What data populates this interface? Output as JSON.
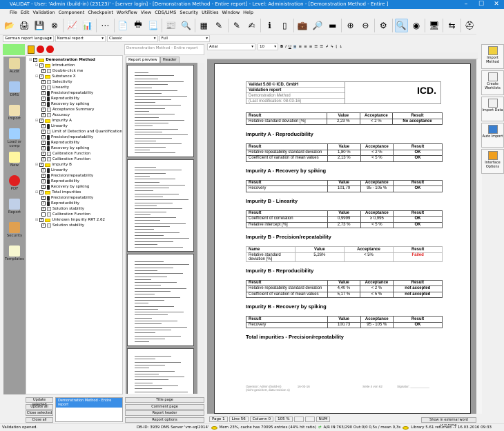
{
  "window": {
    "title": "VALIDAT - User: 'Admin (build-in) (23123)' - [server login] - [Demonstration Method - Entire report] - Level: Administration - [Demonstration Method - Entire ]"
  },
  "menu": [
    "File",
    "Edit",
    "Validation",
    "Component",
    "Checkpoint",
    "Workflow",
    "View",
    "CDS/LIMS",
    "Security",
    "Utilities",
    "Window",
    "Help"
  ],
  "toolbar_icons": [
    "open-icon",
    "print-preview-icon",
    "save-icon",
    "close-icon",
    "chart-icon",
    "bar-chart-icon",
    "network-icon",
    "pdf-icon",
    "print-icon",
    "document-icon",
    "report-icon",
    "search-doc-icon",
    "calculator-icon",
    "edit-icon",
    "edit2-icon",
    "signature-icon",
    "info-doc-icon",
    "page-icon",
    "briefcase-icon",
    "magnify-doc-icon",
    "terminal-icon",
    "zoom-in-icon",
    "zoom-out-icon",
    "refresh-gear-icon",
    "search-icon",
    "auto-import-icon",
    "monitor-icon",
    "exit-icon",
    "help-icon"
  ],
  "options": {
    "language": "German report language",
    "report_type": "Normal report",
    "style": "Classic",
    "scope": "Full"
  },
  "leftnav": [
    "Audit",
    "DMS",
    "Import",
    "Load or comp",
    "New",
    "PDF",
    "Report",
    "Security",
    "Templates"
  ],
  "tree": [
    {
      "d": 0,
      "t": "f",
      "label": "Demonstration Method",
      "bold": true
    },
    {
      "d": 1,
      "t": "f",
      "label": "Introduction"
    },
    {
      "d": 2,
      "t": "d",
      "label": "Double-click me"
    },
    {
      "d": 1,
      "t": "f",
      "label": "Substance X"
    },
    {
      "d": 2,
      "t": "d",
      "label": "Selectivity"
    },
    {
      "d": 2,
      "t": "d",
      "label": "Linearity"
    },
    {
      "d": 2,
      "t": "l",
      "label": "Precision/repeatability"
    },
    {
      "d": 2,
      "t": "l",
      "label": "Reproducibility"
    },
    {
      "d": 2,
      "t": "l",
      "label": "Recovery by spiking"
    },
    {
      "d": 2,
      "t": "d",
      "label": "Acceptance Summary"
    },
    {
      "d": 2,
      "t": "d",
      "label": "Accuracy"
    },
    {
      "d": 1,
      "t": "f",
      "label": "Impurity A"
    },
    {
      "d": 2,
      "t": "l",
      "label": "Linearity"
    },
    {
      "d": 2,
      "t": "d",
      "label": "Limit of Detection and Quantification"
    },
    {
      "d": 2,
      "t": "l",
      "label": "Precision/repeatability"
    },
    {
      "d": 2,
      "t": "l",
      "label": "Reproducibility"
    },
    {
      "d": 2,
      "t": "l",
      "label": "Recovery by spiking"
    },
    {
      "d": 2,
      "t": "d",
      "label": "Calibration Function"
    },
    {
      "d": 2,
      "t": "d",
      "label": "Calibration Function"
    },
    {
      "d": 1,
      "t": "f",
      "label": "Impurity B"
    },
    {
      "d": 2,
      "t": "l",
      "label": "Linearity"
    },
    {
      "d": 2,
      "t": "l",
      "label": "Precision/repeatability"
    },
    {
      "d": 2,
      "t": "l",
      "label": "Reproducibility"
    },
    {
      "d": 2,
      "t": "l",
      "label": "Recovery by spiking"
    },
    {
      "d": 1,
      "t": "f",
      "label": "Total impurities"
    },
    {
      "d": 2,
      "t": "l",
      "label": "Precision/repeatability"
    },
    {
      "d": 2,
      "t": "l",
      "label": "Reproducibility"
    },
    {
      "d": 2,
      "t": "d",
      "label": "Solution stability"
    },
    {
      "d": 2,
      "t": "d",
      "label": "Calibration Function",
      "unchecked": true
    },
    {
      "d": 1,
      "t": "f",
      "label": "Unknown Impurity RRT 2.62"
    },
    {
      "d": 2,
      "t": "d",
      "label": "Solution stability"
    }
  ],
  "middle": {
    "header": "Demonstration Method - Entire report",
    "tabs": [
      "Report preview",
      "Header"
    ]
  },
  "font": {
    "name": "Arial",
    "size": "10",
    "buttons": [
      "B",
      "I",
      "U"
    ]
  },
  "report": {
    "header": [
      "Validat 5.60  © ICD, GmbH",
      "Validation report",
      "Demonstration Method",
      "(Last modification: 08-03-16)"
    ],
    "logo": "ICD.",
    "cols": [
      "Result",
      "Value",
      "Acceptance",
      "Result"
    ],
    "sections": [
      {
        "title": "",
        "rows": [
          [
            "Relative standard deviation [%]",
            "2,23 %",
            "< 2 %",
            "No acceptance"
          ]
        ]
      },
      {
        "title": "Impurity A - Reproducibility",
        "rows": [
          [
            "Relative repeatability standard deviation",
            "1,80 %",
            "< 2 %",
            "OK"
          ],
          [
            "Coefficient of variation of mean values",
            "2,13 %",
            "< 5 %",
            "OK"
          ]
        ]
      },
      {
        "title": "Impurity A - Recovery by spiking",
        "rows": [
          [
            "Recovery",
            "101,79",
            "95 - 105 %",
            "OK"
          ]
        ]
      },
      {
        "title": "Impurity B - Linearity",
        "rows": [
          [
            "Coefficient of correlation",
            "0,9999",
            "≥ 0,995",
            "OK"
          ],
          [
            "Relative intercept [%]",
            "2,73 %",
            "< 5 %",
            "OK"
          ]
        ]
      },
      {
        "title": "Impurity B - Precision/repeatability",
        "light": true,
        "cols": [
          "Name",
          "Value",
          "Acceptance",
          "Result"
        ],
        "rows": [
          [
            "Relative standard deviation [%]",
            "5,26%",
            "< 5%",
            "Failed"
          ]
        ]
      },
      {
        "title": "Impurity B - Reproducibility",
        "rows": [
          [
            "Relative repeatability standard deviation",
            "4,40 %",
            "< 2 %",
            "not accepted"
          ],
          [
            "Coefficient of variation of mean values",
            "5,17 %",
            "< 5 %",
            "not accepted"
          ]
        ]
      },
      {
        "title": "Impurity B - Recovery by spiking",
        "rows": [
          [
            "Recovery",
            "100,73",
            "95 - 105 %",
            "OK"
          ]
        ]
      },
      {
        "title": "Total impurities - Precision/repeatability",
        "rows": []
      }
    ],
    "footer": {
      "operator": "Operator: Admin (build-in)",
      "date": "16-03-16",
      "revision": "(nicht gesichert, data revision 1)",
      "page": "Seite 4 von 62",
      "signature": "Signatur: ___________"
    }
  },
  "right_panel": [
    "Import Method",
    "Create Worklists",
    "Import Data",
    "Auto Import",
    "Interface Options"
  ],
  "bottom_left_buttons": [
    "Update selected",
    "Update all",
    "Close selected",
    "Close all"
  ],
  "open_reports": [
    "Demonstration Method - Entire report"
  ],
  "bottom_mid_buttons": [
    "Title page",
    "Comment page",
    "Report header",
    "Report options"
  ],
  "pageinfo": {
    "page": "Page  1",
    "line": "Line 56",
    "column": "Column  0",
    "zoom": "105 %",
    "num": "NUM",
    "external": "Show in external word processor"
  },
  "status": {
    "message": "Validation opened.",
    "db": "DB-ID: 3939  DMS Server 'vm-sql2014'",
    "mem": "Mem 23%, cache has 70095 entries (44% hit ratio)",
    "ar": "A/R IN:763/290 Out:0/0  0,5s / mean 0,3s",
    "lib": "Library 5.61 returned -7  16.03.2016  09:33"
  },
  "colors": {
    "titlebar": "#1a7fd6",
    "failed": "#e02020",
    "status_green": "#8ef07a"
  }
}
